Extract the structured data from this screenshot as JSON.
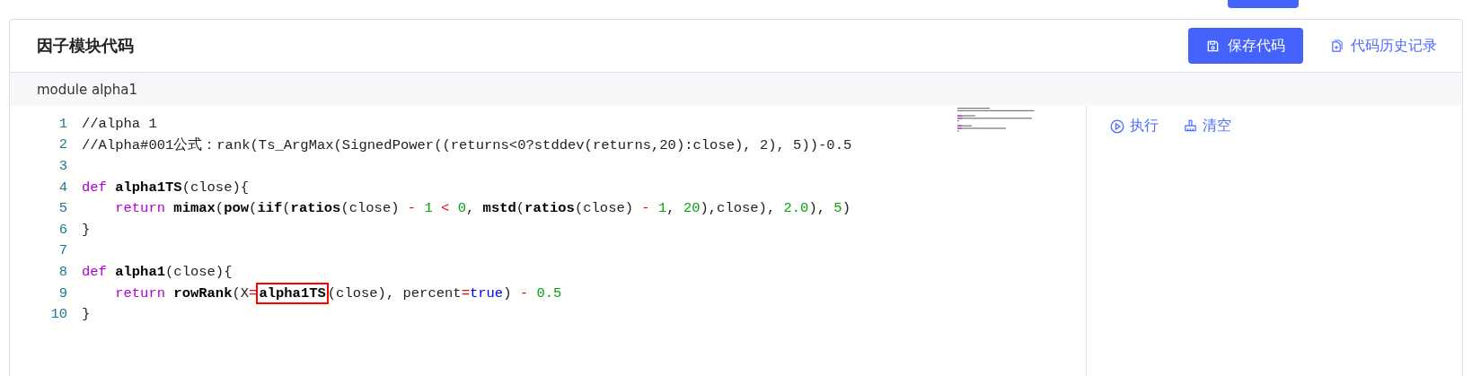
{
  "card": {
    "title": "因子模块代码",
    "save_button": "保存代码",
    "history_link": "代码历史记录"
  },
  "module_bar": {
    "label": "module alpha1"
  },
  "editor": {
    "lines": [
      {
        "number": "1",
        "tokens": [
          {
            "t": "//alpha 1",
            "kind": "plain"
          }
        ]
      },
      {
        "number": "2",
        "tokens": [
          {
            "t": "//Alpha#001公式：rank(Ts_ArgMax(SignedPower((returns<0?stddev(returns,20):close), 2), 5))-0.5",
            "kind": "plain"
          }
        ]
      },
      {
        "number": "3"
      },
      {
        "number": "4",
        "tokens": [
          {
            "t": "def ",
            "kind": "keyword"
          },
          {
            "t": "alpha1TS",
            "kind": "func"
          },
          {
            "t": "(close){",
            "kind": "plain"
          }
        ]
      },
      {
        "number": "5",
        "tokens": [
          {
            "t": "    return ",
            "kind": "keyword"
          },
          {
            "t": "mimax",
            "kind": "func"
          },
          {
            "t": "(",
            "kind": "plain"
          },
          {
            "t": "pow",
            "kind": "func"
          },
          {
            "t": "(",
            "kind": "plain"
          },
          {
            "t": "iif",
            "kind": "func"
          },
          {
            "t": "(",
            "kind": "plain"
          },
          {
            "t": "ratios",
            "kind": "func"
          },
          {
            "t": "(close) ",
            "kind": "plain"
          },
          {
            "t": "- ",
            "kind": "op"
          },
          {
            "t": "1 ",
            "kind": "num"
          },
          {
            "t": "< ",
            "kind": "op"
          },
          {
            "t": "0",
            "kind": "num"
          },
          {
            "t": ", ",
            "kind": "plain"
          },
          {
            "t": "mstd",
            "kind": "func"
          },
          {
            "t": "(",
            "kind": "plain"
          },
          {
            "t": "ratios",
            "kind": "func"
          },
          {
            "t": "(close) ",
            "kind": "plain"
          },
          {
            "t": "- ",
            "kind": "op"
          },
          {
            "t": "1",
            "kind": "num"
          },
          {
            "t": ", ",
            "kind": "plain"
          },
          {
            "t": "20",
            "kind": "num"
          },
          {
            "t": "),close), ",
            "kind": "plain"
          },
          {
            "t": "2.0",
            "kind": "num"
          },
          {
            "t": "), ",
            "kind": "plain"
          },
          {
            "t": "5",
            "kind": "num"
          },
          {
            "t": ")",
            "kind": "plain"
          }
        ]
      },
      {
        "number": "6",
        "tokens": [
          {
            "t": "}",
            "kind": "plain"
          }
        ]
      },
      {
        "number": "7"
      },
      {
        "number": "8",
        "tokens": [
          {
            "t": "def ",
            "kind": "keyword"
          },
          {
            "t": "alpha1",
            "kind": "func"
          },
          {
            "t": "(close){",
            "kind": "plain"
          }
        ]
      },
      {
        "number": "9",
        "tokens": [
          {
            "t": "    return ",
            "kind": "keyword"
          },
          {
            "t": "rowRank",
            "kind": "func"
          },
          {
            "t": "(X",
            "kind": "plain"
          },
          {
            "t": "=",
            "kind": "op"
          },
          {
            "t": "alpha1TS",
            "kind": "func",
            "boxed": true
          },
          {
            "t": "(close), percent",
            "kind": "plain"
          },
          {
            "t": "=",
            "kind": "op"
          },
          {
            "t": "true",
            "kind": "bool"
          },
          {
            "t": ") ",
            "kind": "plain"
          },
          {
            "t": "- ",
            "kind": "op"
          },
          {
            "t": "0.5",
            "kind": "num"
          }
        ]
      },
      {
        "number": "10",
        "tokens": [
          {
            "t": "}",
            "kind": "plain"
          }
        ]
      }
    ]
  },
  "side_panel": {
    "run_button": "执行",
    "clear_button": "清空"
  }
}
